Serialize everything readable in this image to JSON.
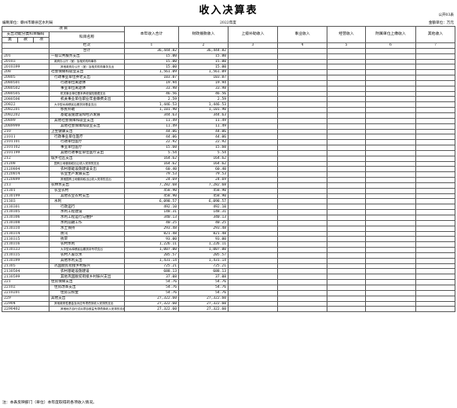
{
  "title": "收入决算表",
  "form_id": "公开03表",
  "meta": {
    "unit": "编制单位：赣州市赣县区水利局",
    "year": "2022年度",
    "currency": "金额单位：万元"
  },
  "header": {
    "project": "项    目",
    "code_group": "支出功能分类科目编码",
    "name": "科目名称",
    "lei": "类",
    "kuan": "款",
    "xiang": "项",
    "columns": [
      "本年收入合计",
      "财政拨款收入",
      "上级补助收入",
      "事业收入",
      "经营收入",
      "附属单位上缴收入",
      "其他收入"
    ],
    "lanci": "栏次",
    "col_numbers": [
      "1",
      "2",
      "3",
      "4",
      "5",
      "6",
      "7"
    ]
  },
  "rows": [
    {
      "code": "",
      "name": "合计",
      "total": "36,444.82",
      "fiscal": "36,444.82"
    },
    {
      "code": "201",
      "name": "一般公共服务支出",
      "total": "15.00",
      "fiscal": "15.00"
    },
    {
      "code": "20103",
      "name": "政府办公厅（室）及相关机构事务",
      "total": "15.00",
      "fiscal": "15.00"
    },
    {
      "code": "2010399",
      "name": "其他政府办公厅（室）及相关机构事务支出",
      "total": "15.00",
      "fiscal": "15.00"
    },
    {
      "code": "208",
      "name": "社会保障和就业支出",
      "total": "1,561.09",
      "fiscal": "1,561.09"
    },
    {
      "code": "20805",
      "name": "行政事业单位养老支出",
      "total": "103.07",
      "fiscal": "103.07"
    },
    {
      "code": "2080501",
      "name": "行政单位离退休",
      "total": "19.94",
      "fiscal": "19.94"
    },
    {
      "code": "2080502",
      "name": "事业单位离退休",
      "total": "33.98",
      "fiscal": "33.98"
    },
    {
      "code": "2080505",
      "name": "机关事业单位基本养老保险缴费支出",
      "total": "46.56",
      "fiscal": "46.56"
    },
    {
      "code": "2080506",
      "name": "机关事业单位职业年金缴费支出",
      "total": "2.59",
      "fiscal": "2.59"
    },
    {
      "code": "20822",
      "name": "大中型水库移民后期扶持基金支出",
      "total": "1,446.53",
      "fiscal": "1,446.53"
    },
    {
      "code": "2082201",
      "name": "移民补助",
      "total": "1,101.90",
      "fiscal": "1,101.90"
    },
    {
      "code": "2082202",
      "name": "基础设施建设和经济发展",
      "total": "344.63",
      "fiscal": "344.63"
    },
    {
      "code": "20899",
      "name": "其他社会保障和就业支出",
      "total": "11.49",
      "fiscal": "11.49"
    },
    {
      "code": "2089999",
      "name": "其他社会保障和就业支出",
      "total": "11.49",
      "fiscal": "11.49"
    },
    {
      "code": "210",
      "name": "卫生健康支出",
      "total": "44.06",
      "fiscal": "44.06"
    },
    {
      "code": "21011",
      "name": "行政事业单位医疗",
      "total": "44.06",
      "fiscal": "44.06"
    },
    {
      "code": "2101101",
      "name": "行政单位医疗",
      "total": "22.92",
      "fiscal": "22.92"
    },
    {
      "code": "2101102",
      "name": "事业单位医疗",
      "total": "15.60",
      "fiscal": "15.60"
    },
    {
      "code": "2101199",
      "name": "其他行政事业单位医疗支出",
      "total": "5.54",
      "fiscal": "5.54"
    },
    {
      "code": "212",
      "name": "城乡社区支出",
      "total": "164.62",
      "fiscal": "164.62"
    },
    {
      "code": "21208",
      "name": "国有土地使用权出让收入安排的支出",
      "total": "164.62",
      "fiscal": "164.62"
    },
    {
      "code": "2120804",
      "name": "农村基础设施建设支出",
      "total": "60.40",
      "fiscal": "60.40"
    },
    {
      "code": "2120814",
      "name": "农业生产发展支出",
      "total": "79.53",
      "fiscal": "79.53"
    },
    {
      "code": "2120899",
      "name": "其他国有土地使用权出让收入安排的支出",
      "total": "24.69",
      "fiscal": "24.69"
    },
    {
      "code": "213",
      "name": "农林水支出",
      "total": "7,282.68",
      "fiscal": "7,282.68"
    },
    {
      "code": "21301",
      "name": "农业农村",
      "total": "458.90",
      "fiscal": "458.90"
    },
    {
      "code": "2130199",
      "name": "其他农业农村支出",
      "total": "458.90",
      "fiscal": "458.90"
    },
    {
      "code": "21303",
      "name": "水利",
      "total": "6,098.57",
      "fiscal": "6,098.57"
    },
    {
      "code": "2130301",
      "name": "行政运行",
      "total": "492.10",
      "fiscal": "492.10"
    },
    {
      "code": "2130305",
      "name": "水利工程建设",
      "total": "148.31",
      "fiscal": "148.31"
    },
    {
      "code": "2130306",
      "name": "水利工程运行与维护",
      "total": "340.13",
      "fiscal": "340.13"
    },
    {
      "code": "2130308",
      "name": "水利前期工作",
      "total": "40.25",
      "fiscal": "40.25"
    },
    {
      "code": "2130310",
      "name": "水土保持",
      "total": "293.48",
      "fiscal": "293.48"
    },
    {
      "code": "2130314",
      "name": "防汛",
      "total": "821.48",
      "fiscal": "821.48"
    },
    {
      "code": "2130315",
      "name": "抗旱",
      "total": "93.00",
      "fiscal": "93.00"
    },
    {
      "code": "2130316",
      "name": "农村水利",
      "total": "1,226.11",
      "fiscal": "1,226.11"
    },
    {
      "code": "2130333",
      "name": "大中型水库移民后期扶持专项支出",
      "total": "1,007.00",
      "fiscal": "1,007.00"
    },
    {
      "code": "2130335",
      "name": "农村人畜饮水",
      "total": "205.57",
      "fiscal": "205.57"
    },
    {
      "code": "2130399",
      "name": "其他水利支出",
      "total": "1,431.14",
      "fiscal": "1,431.14"
    },
    {
      "code": "21305",
      "name": "巩固脱贫衔接乡村振兴",
      "total": "725.21",
      "fiscal": "725.21"
    },
    {
      "code": "2130504",
      "name": "农村基础设施建设",
      "total": "688.13",
      "fiscal": "688.13"
    },
    {
      "code": "2130599",
      "name": "其他巩固脱贫衔接乡村振兴支出",
      "total": "37.08",
      "fiscal": "37.08"
    },
    {
      "code": "221",
      "name": "住房保障支出",
      "total": "54.76",
      "fiscal": "54.76"
    },
    {
      "code": "22102",
      "name": "住房改革支出",
      "total": "54.76",
      "fiscal": "54.76"
    },
    {
      "code": "2210201",
      "name": "住房公积金",
      "total": "54.76",
      "fiscal": "54.76"
    },
    {
      "code": "229",
      "name": "其他支出",
      "total": "27,322.60",
      "fiscal": "27,322.60"
    },
    {
      "code": "22904",
      "name": "其他政府性基金及对应专项债务收入安排的支出",
      "total": "27,322.60",
      "fiscal": "27,322.60"
    },
    {
      "code": "2290402",
      "name": "其他地方自行试点项目收益专项债券收入安排的支出",
      "total": "27,322.60",
      "fiscal": "27,322.60"
    }
  ],
  "footer": "注：本表反映部门（单位）本年度取得的各项收入情况。"
}
